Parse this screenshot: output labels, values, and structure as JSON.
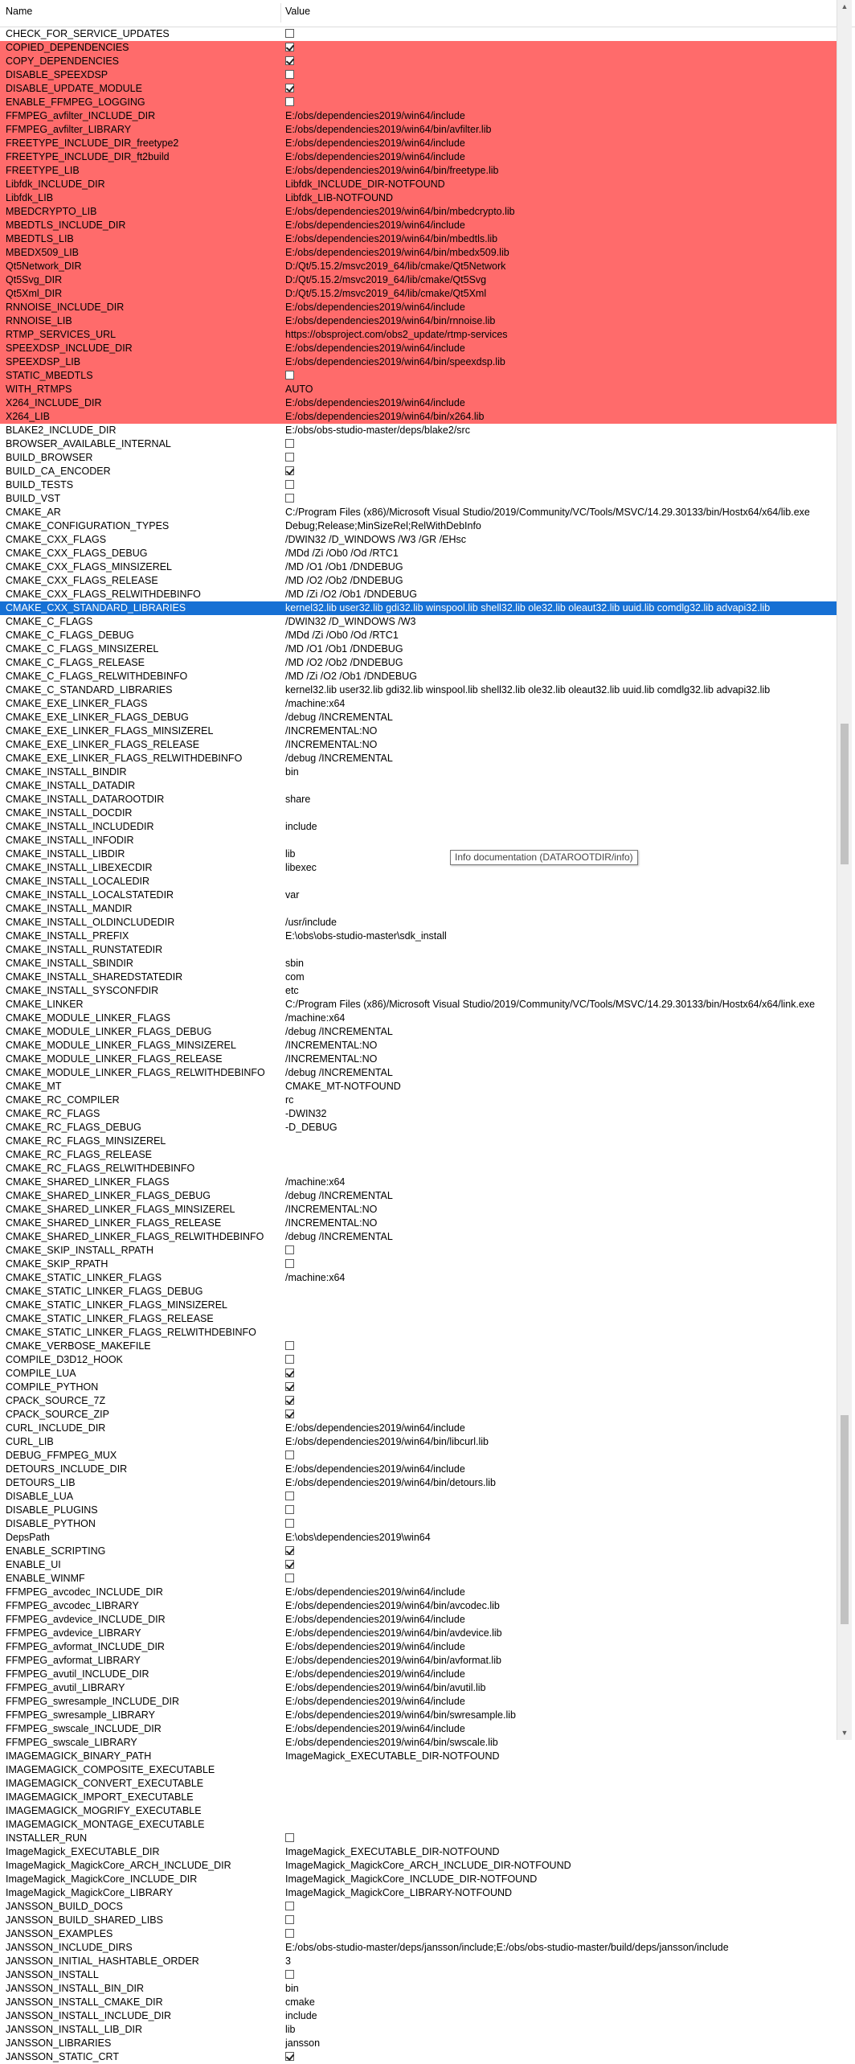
{
  "colors": {
    "changed_row": "#ff6b6b",
    "selected_row": "#1670d4",
    "header_bg": "#ffffff"
  },
  "header": {
    "name": "Name",
    "value": "Value"
  },
  "tooltip": "Info documentation (DATAROOTDIR/info)",
  "rows": [
    {
      "n": "CHECK_FOR_SERVICE_UPDATES",
      "cb": false
    },
    {
      "n": "COPIED_DEPENDENCIES",
      "cb": true,
      "hl": true
    },
    {
      "n": "COPY_DEPENDENCIES",
      "cb": true,
      "hl": true
    },
    {
      "n": "DISABLE_SPEEXDSP",
      "cb": false,
      "hl": true
    },
    {
      "n": "DISABLE_UPDATE_MODULE",
      "cb": true,
      "hl": true
    },
    {
      "n": "ENABLE_FFMPEG_LOGGING",
      "cb": false,
      "hl": true
    },
    {
      "n": "FFMPEG_avfilter_INCLUDE_DIR",
      "v": "E:/obs/dependencies2019/win64/include",
      "hl": true
    },
    {
      "n": "FFMPEG_avfilter_LIBRARY",
      "v": "E:/obs/dependencies2019/win64/bin/avfilter.lib",
      "hl": true
    },
    {
      "n": "FREETYPE_INCLUDE_DIR_freetype2",
      "v": "E:/obs/dependencies2019/win64/include",
      "hl": true
    },
    {
      "n": "FREETYPE_INCLUDE_DIR_ft2build",
      "v": "E:/obs/dependencies2019/win64/include",
      "hl": true
    },
    {
      "n": "FREETYPE_LIB",
      "v": "E:/obs/dependencies2019/win64/bin/freetype.lib",
      "hl": true
    },
    {
      "n": "Libfdk_INCLUDE_DIR",
      "v": "Libfdk_INCLUDE_DIR-NOTFOUND",
      "hl": true
    },
    {
      "n": "Libfdk_LIB",
      "v": "Libfdk_LIB-NOTFOUND",
      "hl": true
    },
    {
      "n": "MBEDCRYPTO_LIB",
      "v": "E:/obs/dependencies2019/win64/bin/mbedcrypto.lib",
      "hl": true
    },
    {
      "n": "MBEDTLS_INCLUDE_DIR",
      "v": "E:/obs/dependencies2019/win64/include",
      "hl": true
    },
    {
      "n": "MBEDTLS_LIB",
      "v": "E:/obs/dependencies2019/win64/bin/mbedtls.lib",
      "hl": true
    },
    {
      "n": "MBEDX509_LIB",
      "v": "E:/obs/dependencies2019/win64/bin/mbedx509.lib",
      "hl": true
    },
    {
      "n": "Qt5Network_DIR",
      "v": "D:/Qt/5.15.2/msvc2019_64/lib/cmake/Qt5Network",
      "hl": true
    },
    {
      "n": "Qt5Svg_DIR",
      "v": "D:/Qt/5.15.2/msvc2019_64/lib/cmake/Qt5Svg",
      "hl": true
    },
    {
      "n": "Qt5Xml_DIR",
      "v": "D:/Qt/5.15.2/msvc2019_64/lib/cmake/Qt5Xml",
      "hl": true
    },
    {
      "n": "RNNOISE_INCLUDE_DIR",
      "v": "E:/obs/dependencies2019/win64/include",
      "hl": true
    },
    {
      "n": "RNNOISE_LIB",
      "v": "E:/obs/dependencies2019/win64/bin/rnnoise.lib",
      "hl": true
    },
    {
      "n": "RTMP_SERVICES_URL",
      "v": "https://obsproject.com/obs2_update/rtmp-services",
      "hl": true
    },
    {
      "n": "SPEEXDSP_INCLUDE_DIR",
      "v": "E:/obs/dependencies2019/win64/include",
      "hl": true
    },
    {
      "n": "SPEEXDSP_LIB",
      "v": "E:/obs/dependencies2019/win64/bin/speexdsp.lib",
      "hl": true
    },
    {
      "n": "STATIC_MBEDTLS",
      "cb": false,
      "hl": true
    },
    {
      "n": "WITH_RTMPS",
      "v": "AUTO",
      "hl": true
    },
    {
      "n": "X264_INCLUDE_DIR",
      "v": "E:/obs/dependencies2019/win64/include",
      "hl": true
    },
    {
      "n": "X264_LIB",
      "v": "E:/obs/dependencies2019/win64/bin/x264.lib",
      "hl": true
    },
    {
      "n": "BLAKE2_INCLUDE_DIR",
      "v": "E:/obs/obs-studio-master/deps/blake2/src"
    },
    {
      "n": "BROWSER_AVAILABLE_INTERNAL",
      "cb": false
    },
    {
      "n": "BUILD_BROWSER",
      "cb": false
    },
    {
      "n": "BUILD_CA_ENCODER",
      "cb": true
    },
    {
      "n": "BUILD_TESTS",
      "cb": false
    },
    {
      "n": "BUILD_VST",
      "cb": false
    },
    {
      "n": "CMAKE_AR",
      "v": "C:/Program Files (x86)/Microsoft Visual Studio/2019/Community/VC/Tools/MSVC/14.29.30133/bin/Hostx64/x64/lib.exe"
    },
    {
      "n": "CMAKE_CONFIGURATION_TYPES",
      "v": "Debug;Release;MinSizeRel;RelWithDebInfo"
    },
    {
      "n": "CMAKE_CXX_FLAGS",
      "v": "/DWIN32 /D_WINDOWS /W3 /GR /EHsc"
    },
    {
      "n": "CMAKE_CXX_FLAGS_DEBUG",
      "v": "/MDd /Zi /Ob0 /Od /RTC1"
    },
    {
      "n": "CMAKE_CXX_FLAGS_MINSIZEREL",
      "v": "/MD /O1 /Ob1 /DNDEBUG"
    },
    {
      "n": "CMAKE_CXX_FLAGS_RELEASE",
      "v": "/MD /O2 /Ob2 /DNDEBUG"
    },
    {
      "n": "CMAKE_CXX_FLAGS_RELWITHDEBINFO",
      "v": "/MD /Zi /O2 /Ob1 /DNDEBUG"
    },
    {
      "n": "CMAKE_CXX_STANDARD_LIBRARIES",
      "v": "kernel32.lib user32.lib gdi32.lib winspool.lib shell32.lib ole32.lib oleaut32.lib uuid.lib comdlg32.lib advapi32.lib",
      "sel": true
    },
    {
      "n": "CMAKE_C_FLAGS",
      "v": "/DWIN32 /D_WINDOWS /W3"
    },
    {
      "n": "CMAKE_C_FLAGS_DEBUG",
      "v": "/MDd /Zi /Ob0 /Od /RTC1"
    },
    {
      "n": "CMAKE_C_FLAGS_MINSIZEREL",
      "v": "/MD /O1 /Ob1 /DNDEBUG"
    },
    {
      "n": "CMAKE_C_FLAGS_RELEASE",
      "v": "/MD /O2 /Ob2 /DNDEBUG"
    },
    {
      "n": "CMAKE_C_FLAGS_RELWITHDEBINFO",
      "v": "/MD /Zi /O2 /Ob1 /DNDEBUG"
    },
    {
      "n": "CMAKE_C_STANDARD_LIBRARIES",
      "v": "kernel32.lib user32.lib gdi32.lib winspool.lib shell32.lib ole32.lib oleaut32.lib uuid.lib comdlg32.lib advapi32.lib"
    },
    {
      "n": "CMAKE_EXE_LINKER_FLAGS",
      "v": "/machine:x64"
    },
    {
      "n": "CMAKE_EXE_LINKER_FLAGS_DEBUG",
      "v": "/debug /INCREMENTAL"
    },
    {
      "n": "CMAKE_EXE_LINKER_FLAGS_MINSIZEREL",
      "v": "/INCREMENTAL:NO"
    },
    {
      "n": "CMAKE_EXE_LINKER_FLAGS_RELEASE",
      "v": "/INCREMENTAL:NO"
    },
    {
      "n": "CMAKE_EXE_LINKER_FLAGS_RELWITHDEBINFO",
      "v": "/debug /INCREMENTAL"
    },
    {
      "n": "CMAKE_INSTALL_BINDIR",
      "v": "bin"
    },
    {
      "n": "CMAKE_INSTALL_DATADIR",
      "v": ""
    },
    {
      "n": "CMAKE_INSTALL_DATAROOTDIR",
      "v": "share"
    },
    {
      "n": "CMAKE_INSTALL_DOCDIR",
      "v": ""
    },
    {
      "n": "CMAKE_INSTALL_INCLUDEDIR",
      "v": "include"
    },
    {
      "n": "CMAKE_INSTALL_INFODIR",
      "v": ""
    },
    {
      "n": "CMAKE_INSTALL_LIBDIR",
      "v": "lib"
    },
    {
      "n": "CMAKE_INSTALL_LIBEXECDIR",
      "v": "libexec"
    },
    {
      "n": "CMAKE_INSTALL_LOCALEDIR",
      "v": ""
    },
    {
      "n": "CMAKE_INSTALL_LOCALSTATEDIR",
      "v": "var"
    },
    {
      "n": "CMAKE_INSTALL_MANDIR",
      "v": ""
    },
    {
      "n": "CMAKE_INSTALL_OLDINCLUDEDIR",
      "v": "/usr/include"
    },
    {
      "n": "CMAKE_INSTALL_PREFIX",
      "v": "E:\\obs\\obs-studio-master\\sdk_install"
    },
    {
      "n": "CMAKE_INSTALL_RUNSTATEDIR",
      "v": ""
    },
    {
      "n": "CMAKE_INSTALL_SBINDIR",
      "v": "sbin"
    },
    {
      "n": "CMAKE_INSTALL_SHAREDSTATEDIR",
      "v": "com"
    },
    {
      "n": "CMAKE_INSTALL_SYSCONFDIR",
      "v": "etc"
    },
    {
      "n": "CMAKE_LINKER",
      "v": "C:/Program Files (x86)/Microsoft Visual Studio/2019/Community/VC/Tools/MSVC/14.29.30133/bin/Hostx64/x64/link.exe"
    },
    {
      "n": "CMAKE_MODULE_LINKER_FLAGS",
      "v": "/machine:x64"
    },
    {
      "n": "CMAKE_MODULE_LINKER_FLAGS_DEBUG",
      "v": "/debug /INCREMENTAL"
    },
    {
      "n": "CMAKE_MODULE_LINKER_FLAGS_MINSIZEREL",
      "v": "/INCREMENTAL:NO"
    },
    {
      "n": "CMAKE_MODULE_LINKER_FLAGS_RELEASE",
      "v": "/INCREMENTAL:NO"
    },
    {
      "n": "CMAKE_MODULE_LINKER_FLAGS_RELWITHDEBINFO",
      "v": "/debug /INCREMENTAL"
    },
    {
      "n": "CMAKE_MT",
      "v": "CMAKE_MT-NOTFOUND"
    },
    {
      "n": "CMAKE_RC_COMPILER",
      "v": "rc"
    },
    {
      "n": "CMAKE_RC_FLAGS",
      "v": "-DWIN32"
    },
    {
      "n": "CMAKE_RC_FLAGS_DEBUG",
      "v": "-D_DEBUG"
    },
    {
      "n": "CMAKE_RC_FLAGS_MINSIZEREL",
      "v": ""
    },
    {
      "n": "CMAKE_RC_FLAGS_RELEASE",
      "v": ""
    },
    {
      "n": "CMAKE_RC_FLAGS_RELWITHDEBINFO",
      "v": ""
    },
    {
      "n": "CMAKE_SHARED_LINKER_FLAGS",
      "v": "/machine:x64"
    },
    {
      "n": "CMAKE_SHARED_LINKER_FLAGS_DEBUG",
      "v": "/debug /INCREMENTAL"
    },
    {
      "n": "CMAKE_SHARED_LINKER_FLAGS_MINSIZEREL",
      "v": "/INCREMENTAL:NO"
    },
    {
      "n": "CMAKE_SHARED_LINKER_FLAGS_RELEASE",
      "v": "/INCREMENTAL:NO"
    },
    {
      "n": "CMAKE_SHARED_LINKER_FLAGS_RELWITHDEBINFO",
      "v": "/debug /INCREMENTAL"
    },
    {
      "n": "CMAKE_SKIP_INSTALL_RPATH",
      "cb": false
    },
    {
      "n": "CMAKE_SKIP_RPATH",
      "cb": false
    },
    {
      "n": "CMAKE_STATIC_LINKER_FLAGS",
      "v": "/machine:x64"
    },
    {
      "n": "CMAKE_STATIC_LINKER_FLAGS_DEBUG",
      "v": ""
    },
    {
      "n": "CMAKE_STATIC_LINKER_FLAGS_MINSIZEREL",
      "v": ""
    },
    {
      "n": "CMAKE_STATIC_LINKER_FLAGS_RELEASE",
      "v": ""
    },
    {
      "n": "CMAKE_STATIC_LINKER_FLAGS_RELWITHDEBINFO",
      "v": ""
    },
    {
      "n": "CMAKE_VERBOSE_MAKEFILE",
      "cb": false
    },
    {
      "n": "COMPILE_D3D12_HOOK",
      "cb": false
    },
    {
      "n": "COMPILE_LUA",
      "cb": true
    },
    {
      "n": "COMPILE_PYTHON",
      "cb": true
    },
    {
      "n": "CPACK_SOURCE_7Z",
      "cb": true
    },
    {
      "n": "CPACK_SOURCE_ZIP",
      "cb": true
    },
    {
      "n": "CURL_INCLUDE_DIR",
      "v": "E:/obs/dependencies2019/win64/include"
    },
    {
      "n": "CURL_LIB",
      "v": "E:/obs/dependencies2019/win64/bin/libcurl.lib"
    },
    {
      "n": "DEBUG_FFMPEG_MUX",
      "cb": false
    },
    {
      "n": "DETOURS_INCLUDE_DIR",
      "v": "E:/obs/dependencies2019/win64/include"
    },
    {
      "n": "DETOURS_LIB",
      "v": "E:/obs/dependencies2019/win64/bin/detours.lib"
    },
    {
      "n": "DISABLE_LUA",
      "cb": false
    },
    {
      "n": "DISABLE_PLUGINS",
      "cb": false
    },
    {
      "n": "DISABLE_PYTHON",
      "cb": false
    },
    {
      "n": "DepsPath",
      "v": "E:\\obs\\dependencies2019\\win64"
    },
    {
      "n": "ENABLE_SCRIPTING",
      "cb": true
    },
    {
      "n": "ENABLE_UI",
      "cb": true
    },
    {
      "n": "ENABLE_WINMF",
      "cb": false
    },
    {
      "n": "FFMPEG_avcodec_INCLUDE_DIR",
      "v": "E:/obs/dependencies2019/win64/include"
    },
    {
      "n": "FFMPEG_avcodec_LIBRARY",
      "v": "E:/obs/dependencies2019/win64/bin/avcodec.lib"
    },
    {
      "n": "FFMPEG_avdevice_INCLUDE_DIR",
      "v": "E:/obs/dependencies2019/win64/include"
    },
    {
      "n": "FFMPEG_avdevice_LIBRARY",
      "v": "E:/obs/dependencies2019/win64/bin/avdevice.lib"
    },
    {
      "n": "FFMPEG_avformat_INCLUDE_DIR",
      "v": "E:/obs/dependencies2019/win64/include"
    },
    {
      "n": "FFMPEG_avformat_LIBRARY",
      "v": "E:/obs/dependencies2019/win64/bin/avformat.lib"
    },
    {
      "n": "FFMPEG_avutil_INCLUDE_DIR",
      "v": "E:/obs/dependencies2019/win64/include"
    },
    {
      "n": "FFMPEG_avutil_LIBRARY",
      "v": "E:/obs/dependencies2019/win64/bin/avutil.lib"
    },
    {
      "n": "FFMPEG_swresample_INCLUDE_DIR",
      "v": "E:/obs/dependencies2019/win64/include"
    },
    {
      "n": "FFMPEG_swresample_LIBRARY",
      "v": "E:/obs/dependencies2019/win64/bin/swresample.lib"
    },
    {
      "n": "FFMPEG_swscale_INCLUDE_DIR",
      "v": "E:/obs/dependencies2019/win64/include"
    },
    {
      "n": "FFMPEG_swscale_LIBRARY",
      "v": "E:/obs/dependencies2019/win64/bin/swscale.lib"
    },
    {
      "n": "IMAGEMAGICK_BINARY_PATH",
      "v": "ImageMagick_EXECUTABLE_DIR-NOTFOUND"
    },
    {
      "n": "IMAGEMAGICK_COMPOSITE_EXECUTABLE",
      "v": ""
    },
    {
      "n": "IMAGEMAGICK_CONVERT_EXECUTABLE",
      "v": ""
    },
    {
      "n": "IMAGEMAGICK_IMPORT_EXECUTABLE",
      "v": ""
    },
    {
      "n": "IMAGEMAGICK_MOGRIFY_EXECUTABLE",
      "v": ""
    },
    {
      "n": "IMAGEMAGICK_MONTAGE_EXECUTABLE",
      "v": ""
    },
    {
      "n": "INSTALLER_RUN",
      "cb": false
    },
    {
      "n": "ImageMagick_EXECUTABLE_DIR",
      "v": "ImageMagick_EXECUTABLE_DIR-NOTFOUND"
    },
    {
      "n": "ImageMagick_MagickCore_ARCH_INCLUDE_DIR",
      "v": "ImageMagick_MagickCore_ARCH_INCLUDE_DIR-NOTFOUND"
    },
    {
      "n": "ImageMagick_MagickCore_INCLUDE_DIR",
      "v": "ImageMagick_MagickCore_INCLUDE_DIR-NOTFOUND"
    },
    {
      "n": "ImageMagick_MagickCore_LIBRARY",
      "v": "ImageMagick_MagickCore_LIBRARY-NOTFOUND"
    },
    {
      "n": "JANSSON_BUILD_DOCS",
      "cb": false
    },
    {
      "n": "JANSSON_BUILD_SHARED_LIBS",
      "cb": false
    },
    {
      "n": "JANSSON_EXAMPLES",
      "cb": false
    },
    {
      "n": "JANSSON_INCLUDE_DIRS",
      "v": "E:/obs/obs-studio-master/deps/jansson/include;E:/obs/obs-studio-master/build/deps/jansson/include"
    },
    {
      "n": "JANSSON_INITIAL_HASHTABLE_ORDER",
      "v": "3"
    },
    {
      "n": "JANSSON_INSTALL",
      "cb": false
    },
    {
      "n": "JANSSON_INSTALL_BIN_DIR",
      "v": "bin"
    },
    {
      "n": "JANSSON_INSTALL_CMAKE_DIR",
      "v": "cmake"
    },
    {
      "n": "JANSSON_INSTALL_INCLUDE_DIR",
      "v": "include"
    },
    {
      "n": "JANSSON_INSTALL_LIB_DIR",
      "v": "lib"
    },
    {
      "n": "JANSSON_LIBRARIES",
      "v": "jansson"
    },
    {
      "n": "JANSSON_STATIC_CRT",
      "cb": true
    }
  ]
}
